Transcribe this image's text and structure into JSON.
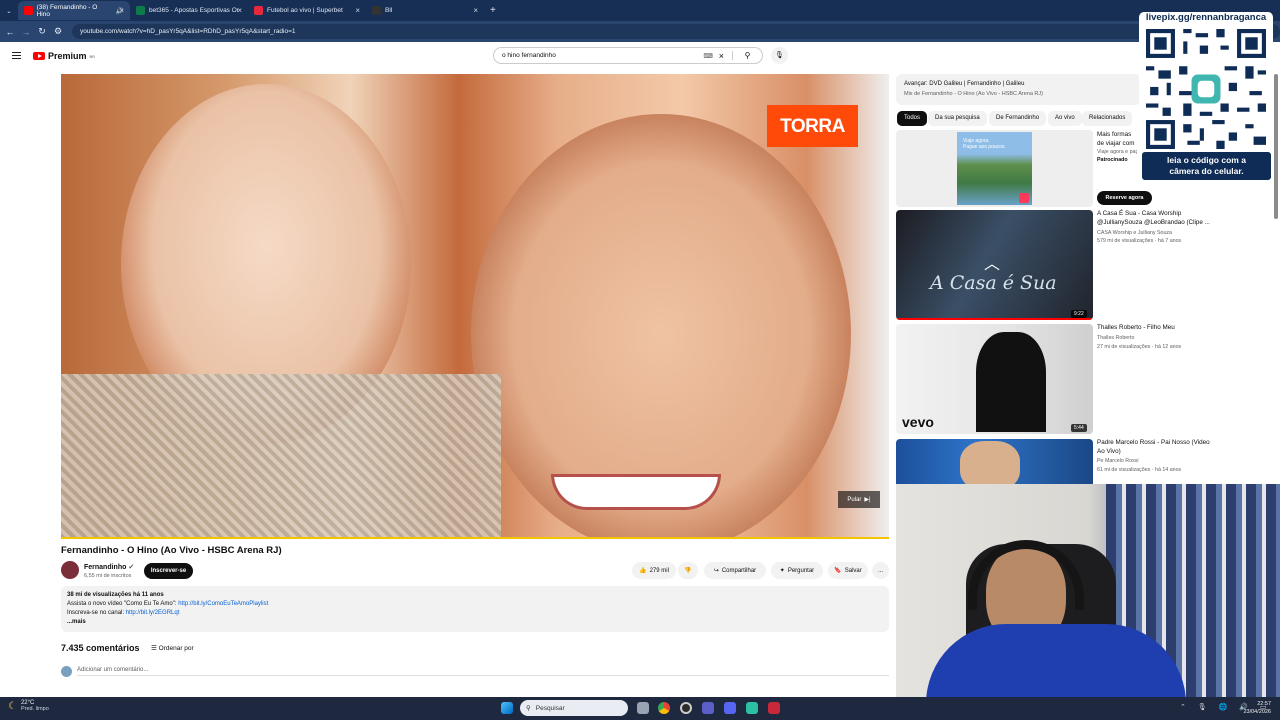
{
  "browser": {
    "tabs": [
      {
        "label": "(38) Fernandinho - O Hino",
        "color": "#ff0000",
        "active": true
      },
      {
        "label": "bet365 - Apostas Esportivas Or",
        "color": "#0f7a4a",
        "active": false
      },
      {
        "label": "Futebol ao vivo | Superbet",
        "color": "#e8283b",
        "active": false
      },
      {
        "label": "Bll",
        "color": "#333333",
        "active": false
      }
    ],
    "new_tab": "+",
    "url": "youtube.com/watch?v=hD_pasYr5qA&list=RDhD_pasYr5qA&start_radio=1"
  },
  "header": {
    "logo": "Premium",
    "logo_sup": "BR",
    "search_value": "o hino fernandinho"
  },
  "video": {
    "ad_brand": "TORRA",
    "skip_label": "Pular",
    "title": "Fernandinho - O Hino (Ao Vivo - HSBC Arena RJ)",
    "channel": "Fernandinho",
    "subscribers": "6,55 mi de inscritos",
    "subscribe": "Inscrever-se",
    "likes": "279 mil",
    "share": "Compartilhar",
    "ask": "Perguntar",
    "save": "Salvar",
    "more": "...",
    "desc_stats": "38 mi de visualizações  há 11 anos",
    "desc_line1": "Assista o novo vídeo \"Como Eu Te Amo\": ",
    "desc_link1": "http://bit.ly/ComoEuTeAmoPlaylist",
    "desc_line2": "Inscreva-se no canal: ",
    "desc_link2": "http://bit.ly/2EGRLqt",
    "desc_more": "...mais",
    "comments_count": "7.435 comentários",
    "sort": "Ordenar por",
    "add_comment": "Adicionar um comentário..."
  },
  "sidebar": {
    "mix_title": "Avançar: DVD Galileu | Fernandinho | Galileu",
    "mix_sub": "Mix de Fernandinho - O Hino (Ao Vivo - HSBC Arena RJ)",
    "chips": [
      "Todos",
      "Da sua pesquisa",
      "De Fernandinho",
      "Ao vivo",
      "Relacionados"
    ],
    "ad": {
      "thumb_text1": "Viaje agora.",
      "thumb_text2": "Pague aos poucos.",
      "title": "Mais formas de viajar com flexibilidade",
      "sub": "Viaje agora e pague aos poucos.",
      "sponsored": "Patrocinado",
      "button": "Reserve agora"
    },
    "recs": [
      {
        "title": "A Casa É Sua - Casa Worship @JullianySouza @LeoBrandao (Clipe ...",
        "channel": "CASA Worship e Julliany Souza",
        "meta": "579 mi de visualizações · há 7 anos",
        "duration": "9:22",
        "overlay": "A Casa é Sua"
      },
      {
        "title": "Thalles Roberto - Filho Meu",
        "channel": "Thalles Roberto",
        "meta": "27 mi de visualizações · há 12 anos",
        "duration": "5:44",
        "overlay": "vevo"
      },
      {
        "title": "Padre Marcelo Rossi - Pai Nosso (Video Ao Vivo)",
        "channel": "Pe Marcelo Rossi",
        "meta": "61 mi de visualizações · há 14 anos",
        "duration": "",
        "overlay": ""
      }
    ]
  },
  "overlay": {
    "pix_url": "livepix.gg/rennanbraganca",
    "caption1": "leia o código com a",
    "caption2": "câmera do celular."
  },
  "taskbar": {
    "weather_temp": "22°C",
    "weather_desc": "Pred. limpo",
    "search": "Pesquisar",
    "time": "22:57",
    "date": "23/04/2026"
  },
  "colors": {
    "accent_red": "#ff0000",
    "link": "#065fd4",
    "torra": "#ff4a0a",
    "tab_bar": "#172f54"
  }
}
